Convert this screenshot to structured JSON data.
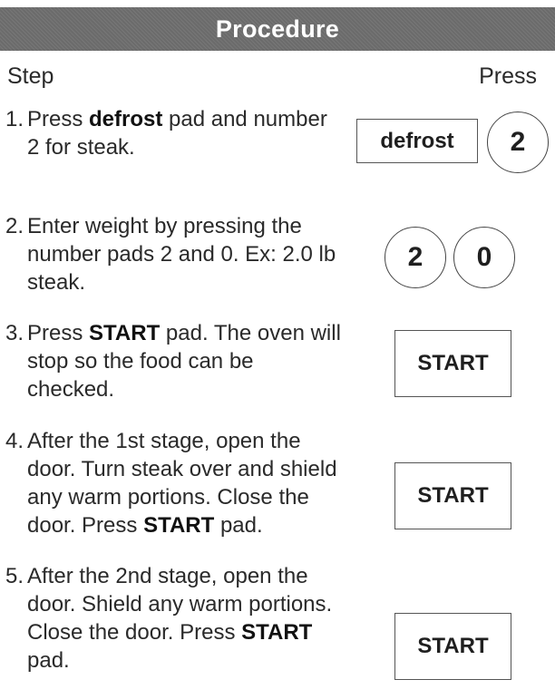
{
  "header": {
    "title": "Procedure"
  },
  "columns": {
    "step": "Step",
    "press": "Press"
  },
  "steps": [
    {
      "number": "1.",
      "parts": [
        {
          "text": "Press ",
          "bold": false
        },
        {
          "text": "defrost",
          "bold": true
        },
        {
          "text": " pad and number 2 for steak.",
          "bold": false
        }
      ],
      "pads": [
        {
          "type": "pad",
          "label": "defrost"
        },
        {
          "type": "number",
          "label": "2"
        }
      ]
    },
    {
      "number": "2.",
      "parts": [
        {
          "text": "Enter weight by pressing the number pads 2 and 0. Ex: 2.0 lb steak.",
          "bold": false
        }
      ],
      "pads": [
        {
          "type": "number",
          "label": "2"
        },
        {
          "type": "number",
          "label": "0"
        }
      ]
    },
    {
      "number": "3.",
      "parts": [
        {
          "text": "Press ",
          "bold": false
        },
        {
          "text": "START",
          "bold": true
        },
        {
          "text": " pad. The oven will stop so the food can be checked.",
          "bold": false
        }
      ],
      "pads": [
        {
          "type": "pad",
          "label": "START"
        }
      ]
    },
    {
      "number": "4.",
      "parts": [
        {
          "text": "After the 1st stage, open the door. Turn steak over and shield any warm portions. Close the door. Press ",
          "bold": false
        },
        {
          "text": "START",
          "bold": true
        },
        {
          "text": " pad.",
          "bold": false
        }
      ],
      "pads": [
        {
          "type": "pad",
          "label": "START"
        }
      ]
    },
    {
      "number": "5.",
      "parts": [
        {
          "text": "After the 2nd stage, open the door. Shield any warm portions. Close the door. Press ",
          "bold": false
        },
        {
          "text": "START",
          "bold": true
        },
        {
          "text": " pad.",
          "bold": false
        }
      ],
      "pads": [
        {
          "type": "pad",
          "label": "START"
        }
      ]
    }
  ]
}
